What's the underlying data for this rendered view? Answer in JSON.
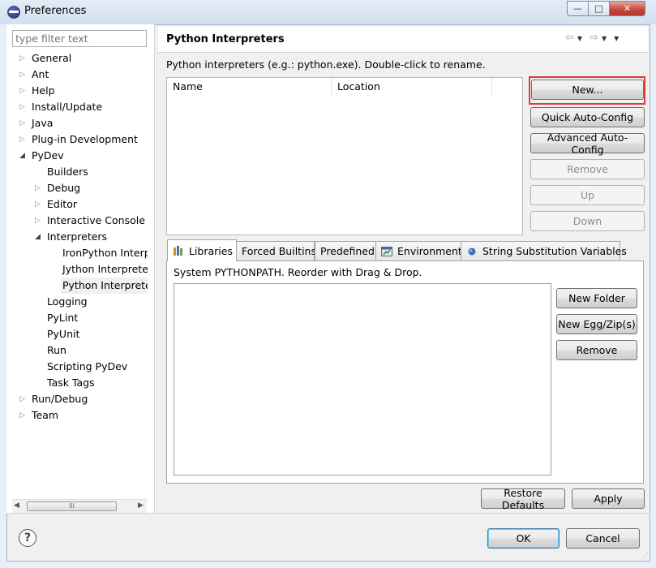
{
  "window": {
    "title": "Preferences",
    "controls": {
      "minimize": "—",
      "maximize": "□",
      "close": "✕"
    }
  },
  "filter": {
    "placeholder": "type filter text",
    "value": ""
  },
  "tree": [
    {
      "label": "General",
      "level": 0,
      "state": "collapsed"
    },
    {
      "label": "Ant",
      "level": 0,
      "state": "collapsed"
    },
    {
      "label": "Help",
      "level": 0,
      "state": "collapsed"
    },
    {
      "label": "Install/Update",
      "level": 0,
      "state": "collapsed"
    },
    {
      "label": "Java",
      "level": 0,
      "state": "collapsed"
    },
    {
      "label": "Plug-in Development",
      "level": 0,
      "state": "collapsed"
    },
    {
      "label": "PyDev",
      "level": 0,
      "state": "expanded"
    },
    {
      "label": "Builders",
      "level": 1,
      "state": "leaf"
    },
    {
      "label": "Debug",
      "level": 1,
      "state": "collapsed"
    },
    {
      "label": "Editor",
      "level": 1,
      "state": "collapsed"
    },
    {
      "label": "Interactive Console",
      "level": 1,
      "state": "collapsed"
    },
    {
      "label": "Interpreters",
      "level": 1,
      "state": "expanded"
    },
    {
      "label": "IronPython Interpreter",
      "level": 2,
      "state": "leaf"
    },
    {
      "label": "Jython Interpreter",
      "level": 2,
      "state": "leaf"
    },
    {
      "label": "Python Interpreter",
      "level": 2,
      "state": "leaf",
      "selected": true
    },
    {
      "label": "Logging",
      "level": 1,
      "state": "leaf"
    },
    {
      "label": "PyLint",
      "level": 1,
      "state": "leaf"
    },
    {
      "label": "PyUnit",
      "level": 1,
      "state": "leaf"
    },
    {
      "label": "Run",
      "level": 1,
      "state": "leaf"
    },
    {
      "label": "Scripting PyDev",
      "level": 1,
      "state": "leaf"
    },
    {
      "label": "Task Tags",
      "level": 1,
      "state": "leaf"
    },
    {
      "label": "Run/Debug",
      "level": 0,
      "state": "collapsed"
    },
    {
      "label": "Team",
      "level": 0,
      "state": "collapsed"
    }
  ],
  "tree_scroll": {
    "thumb_grip": "III",
    "left_arrow": "◀",
    "right_arrow": "▶"
  },
  "page": {
    "title": "Python Interpreters",
    "nav": {
      "back": "⇦",
      "forward": "⇨",
      "dropdown": "▼",
      "menu": "▼"
    },
    "description": "Python interpreters (e.g.: python.exe).   Double-click to rename.",
    "table": {
      "columns": [
        "Name",
        "Location"
      ],
      "rows": []
    },
    "buttons": {
      "new": "New...",
      "quick_auto_config": "Quick Auto-Config",
      "advanced_auto_config": "Advanced Auto-Config",
      "remove": "Remove",
      "up": "Up",
      "down": "Down"
    },
    "tabs": [
      {
        "label": "Libraries",
        "icon": "libraries-icon",
        "active": true
      },
      {
        "label": "Forced Builtins",
        "active": false
      },
      {
        "label": "Predefined",
        "active": false
      },
      {
        "label": "Environment",
        "icon": "environment-icon",
        "active": false
      },
      {
        "label": "String Substitution Variables",
        "icon": "variables-icon",
        "active": false
      }
    ],
    "libraries": {
      "description": "System PYTHONPATH.   Reorder with Drag & Drop.",
      "items": [],
      "buttons": {
        "new_folder": "New Folder",
        "new_egg": "New Egg/Zip(s)",
        "remove": "Remove"
      }
    },
    "restore_defaults": "Restore Defaults",
    "apply": "Apply"
  },
  "dialog": {
    "ok": "OK",
    "cancel": "Cancel",
    "help_glyph": "?"
  },
  "colors": {
    "highlight": "#e03a3a",
    "default_button": "#3c7fb1"
  }
}
